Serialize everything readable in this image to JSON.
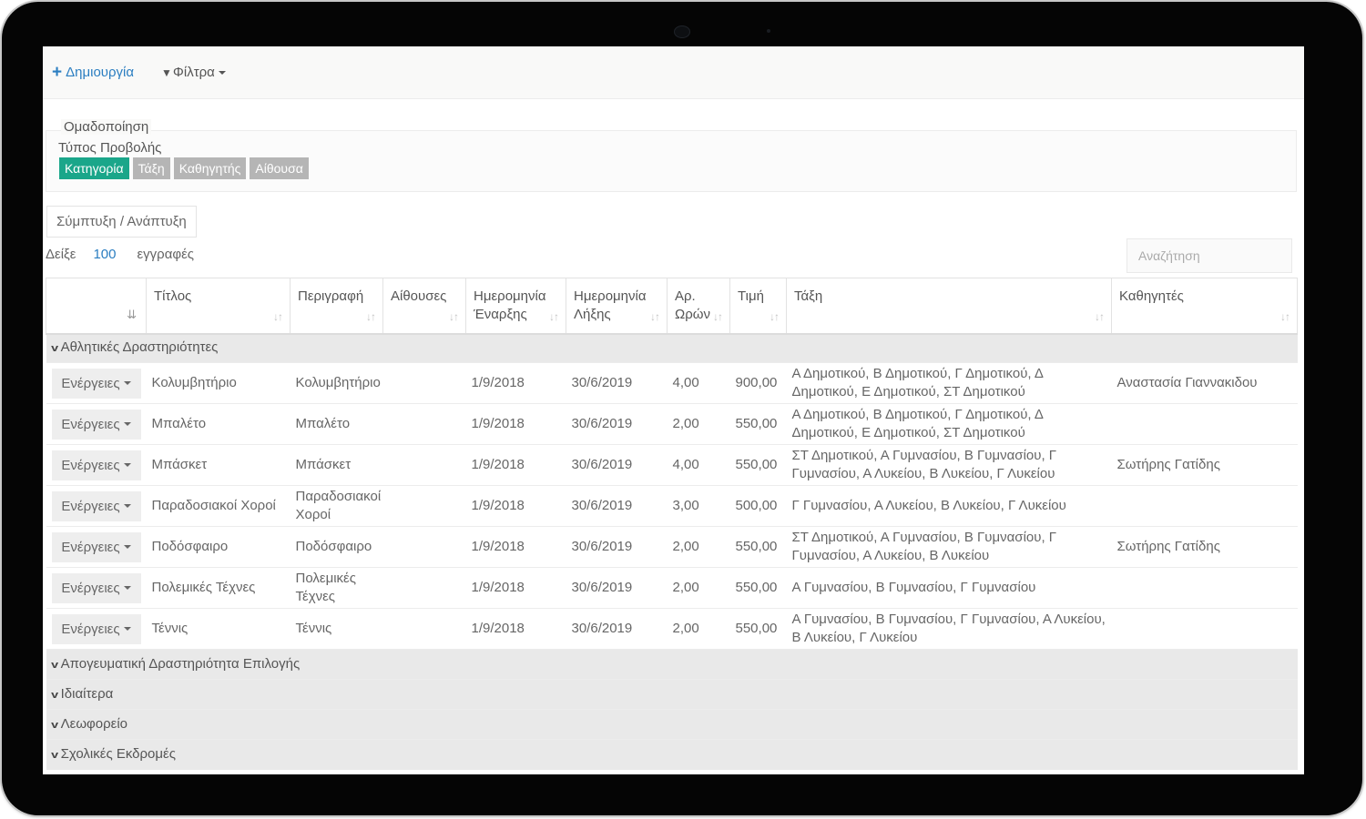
{
  "toolbar": {
    "create_label": "Δημιουργία",
    "filters_label": "Φίλτρα"
  },
  "grouping": {
    "legend": "Ομαδοποίηση",
    "view_type_label": "Τύπος Προβολής",
    "options": [
      "Κατηγορία",
      "Τάξη",
      "Καθηγητής",
      "Αίθουσα"
    ],
    "active": "Κατηγορία"
  },
  "collapse_label": "Σύμπτυξη / Ανάπτυξη",
  "length": {
    "prefix": "Δείξε",
    "value": "100",
    "suffix": "εγγραφές"
  },
  "search": {
    "placeholder": "Αναζήτηση"
  },
  "table": {
    "columns": [
      "Τίτλος",
      "Περιγραφή",
      "Αίθουσες",
      "Ημερομηνία Έναρξης",
      "Ημερομηνία Λήξης",
      "Αρ. Ωρών",
      "Τιμή",
      "Τάξη",
      "Καθηγητές"
    ],
    "actions_label": "Ενέργειες",
    "groups": [
      {
        "name": "Αθλητικές Δραστηριότητες",
        "rows": [
          [
            "Κολυμβητήριο",
            "Κολυμβητήριο",
            "",
            "1/9/2018",
            "30/6/2019",
            "4,00",
            "900,00",
            "Α Δημοτικού, Β Δημοτικού, Γ Δημοτικού, Δ Δημοτικού, Ε Δημοτικού, ΣΤ Δημοτικού",
            "Αναστασία Γιαννακιδου"
          ],
          [
            "Μπαλέτο",
            "Μπαλέτο",
            "",
            "1/9/2018",
            "30/6/2019",
            "2,00",
            "550,00",
            "Α Δημοτικού, Β Δημοτικού, Γ Δημοτικού, Δ Δημοτικού, Ε Δημοτικού, ΣΤ Δημοτικού",
            ""
          ],
          [
            "Μπάσκετ",
            "Μπάσκετ",
            "",
            "1/9/2018",
            "30/6/2019",
            "4,00",
            "550,00",
            "ΣΤ Δημοτικού, Α Γυμνασίου, Β Γυμνασίου, Γ Γυμνασίου, Α Λυκείου, Β Λυκείου, Γ Λυκείου",
            "Σωτήρης Γατίδης"
          ],
          [
            "Παραδοσιακοί Χοροί",
            "Παραδοσιακοί Χοροί",
            "",
            "1/9/2018",
            "30/6/2019",
            "3,00",
            "500,00",
            "Γ Γυμνασίου, Α Λυκείου, Β Λυκείου, Γ Λυκείου",
            ""
          ],
          [
            "Ποδόσφαιρο",
            "Ποδόσφαιρο",
            "",
            "1/9/2018",
            "30/6/2019",
            "2,00",
            "550,00",
            "ΣΤ Δημοτικού, Α Γυμνασίου, Β Γυμνασίου, Γ Γυμνασίου, Α Λυκείου, Β Λυκείου",
            "Σωτήρης Γατίδης"
          ],
          [
            "Πολεμικές Τέχνες",
            "Πολεμικές Τέχνες",
            "",
            "1/9/2018",
            "30/6/2019",
            "2,00",
            "550,00",
            "Α Γυμνασίου, Β Γυμνασίου, Γ Γυμνασίου",
            ""
          ],
          [
            "Τέννις",
            "Τέννις",
            "",
            "1/9/2018",
            "30/6/2019",
            "2,00",
            "550,00",
            "Α Γυμνασίου, Β Γυμνασίου, Γ Γυμνασίου, Α Λυκείου, Β Λυκείου, Γ Λυκείου",
            ""
          ]
        ]
      },
      {
        "name": "Απογευματική Δραστηριότητα Επιλογής",
        "rows": []
      },
      {
        "name": "Ιδιαίτερα",
        "rows": []
      },
      {
        "name": "Λεωφορείο",
        "rows": []
      },
      {
        "name": "Σχολικές Εκδρομές",
        "rows": []
      }
    ]
  },
  "colors": {
    "accent": "#1aa68a",
    "link": "#2b7ec1",
    "inactive_button": "#b5b5b5",
    "group_row": "#e9e9e9"
  },
  "icons": {
    "create": "plus-icon",
    "filter": "funnel-icon",
    "sort": "sort-icon",
    "group_toggle": "chevron-down-icon"
  }
}
